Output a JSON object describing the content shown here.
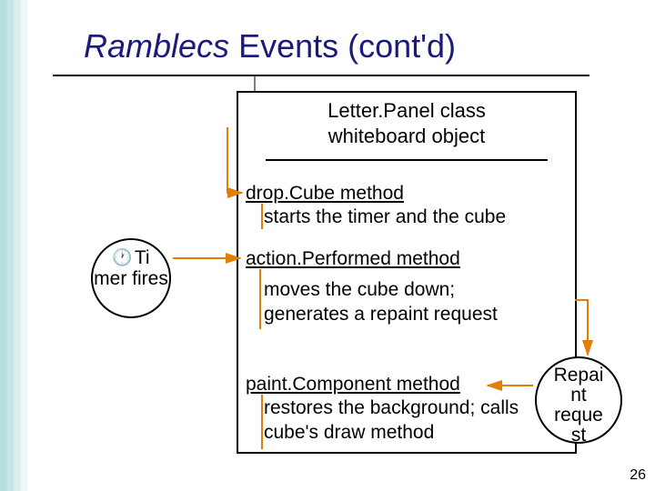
{
  "title": {
    "italic": "Ramblecs",
    "rest": " Events (cont'd)"
  },
  "classHeader": {
    "line1": "Letter.Panel class",
    "line2": "whiteboard object"
  },
  "section1": {
    "title": "drop.Cube method",
    "body": "starts the timer and the cube"
  },
  "section2": {
    "title": "action.Performed method",
    "body": "moves the cube down;\ngenerates a repaint request"
  },
  "section3": {
    "title": "paint.Component method",
    "body": "restores the background;  calls cube's draw method"
  },
  "timerBubble": {
    "icon": "🕐",
    "text": "Ti\nmer fires"
  },
  "repaintBubble": {
    "text": "Repai\nnt\nreque\nst"
  },
  "pageNumber": "26",
  "colors": {
    "titleColor": "#1a1a7a",
    "arrow": "#e37d06"
  }
}
